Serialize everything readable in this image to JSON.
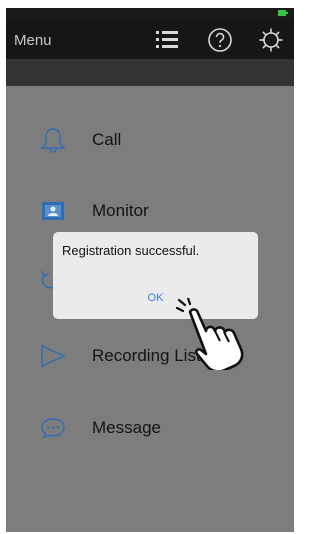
{
  "header": {
    "title": "Menu",
    "icons": [
      "list-icon",
      "help-icon",
      "gear-icon"
    ]
  },
  "status_bar": {
    "icons": [
      "battery-icon"
    ]
  },
  "menu": {
    "items": [
      {
        "label": "Call",
        "icon": "bell-icon"
      },
      {
        "label": "Monitor",
        "icon": "monitor-icon"
      },
      {
        "label": "",
        "icon": "playback-icon"
      },
      {
        "label": "Recording List",
        "icon": "play-icon"
      },
      {
        "label": "Message",
        "icon": "message-icon"
      }
    ]
  },
  "dialog": {
    "message": "Registration successful.",
    "ok_label": "OK"
  },
  "colors": {
    "header_bg": "#161616",
    "overlay_bg": "#7d7d7d",
    "accent": "#3d7fd6",
    "icon_blue": "#2d6fb5"
  }
}
